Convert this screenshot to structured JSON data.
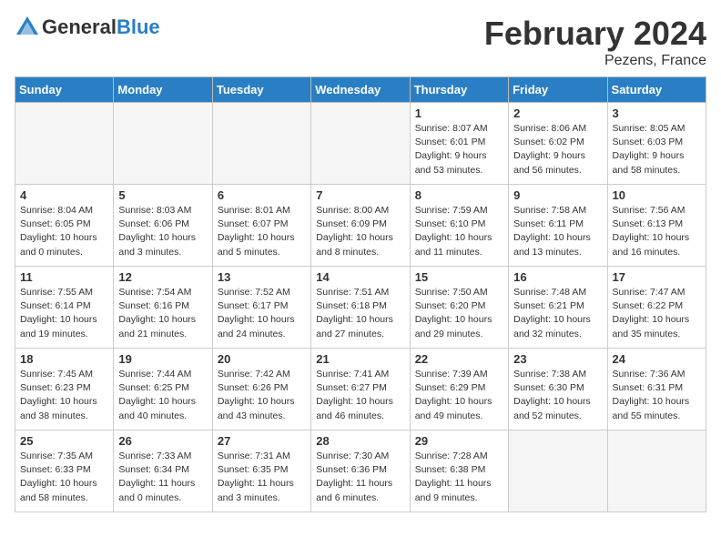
{
  "header": {
    "logo_general": "General",
    "logo_blue": "Blue",
    "month_year": "February 2024",
    "location": "Pezens, France"
  },
  "weekdays": [
    "Sunday",
    "Monday",
    "Tuesday",
    "Wednesday",
    "Thursday",
    "Friday",
    "Saturday"
  ],
  "weeks": [
    [
      {
        "day": "",
        "empty": true
      },
      {
        "day": "",
        "empty": true
      },
      {
        "day": "",
        "empty": true
      },
      {
        "day": "",
        "empty": true
      },
      {
        "day": "1",
        "sunrise": "Sunrise: 8:07 AM",
        "sunset": "Sunset: 6:01 PM",
        "daylight": "Daylight: 9 hours and 53 minutes."
      },
      {
        "day": "2",
        "sunrise": "Sunrise: 8:06 AM",
        "sunset": "Sunset: 6:02 PM",
        "daylight": "Daylight: 9 hours and 56 minutes."
      },
      {
        "day": "3",
        "sunrise": "Sunrise: 8:05 AM",
        "sunset": "Sunset: 6:03 PM",
        "daylight": "Daylight: 9 hours and 58 minutes."
      }
    ],
    [
      {
        "day": "4",
        "sunrise": "Sunrise: 8:04 AM",
        "sunset": "Sunset: 6:05 PM",
        "daylight": "Daylight: 10 hours and 0 minutes."
      },
      {
        "day": "5",
        "sunrise": "Sunrise: 8:03 AM",
        "sunset": "Sunset: 6:06 PM",
        "daylight": "Daylight: 10 hours and 3 minutes."
      },
      {
        "day": "6",
        "sunrise": "Sunrise: 8:01 AM",
        "sunset": "Sunset: 6:07 PM",
        "daylight": "Daylight: 10 hours and 5 minutes."
      },
      {
        "day": "7",
        "sunrise": "Sunrise: 8:00 AM",
        "sunset": "Sunset: 6:09 PM",
        "daylight": "Daylight: 10 hours and 8 minutes."
      },
      {
        "day": "8",
        "sunrise": "Sunrise: 7:59 AM",
        "sunset": "Sunset: 6:10 PM",
        "daylight": "Daylight: 10 hours and 11 minutes."
      },
      {
        "day": "9",
        "sunrise": "Sunrise: 7:58 AM",
        "sunset": "Sunset: 6:11 PM",
        "daylight": "Daylight: 10 hours and 13 minutes."
      },
      {
        "day": "10",
        "sunrise": "Sunrise: 7:56 AM",
        "sunset": "Sunset: 6:13 PM",
        "daylight": "Daylight: 10 hours and 16 minutes."
      }
    ],
    [
      {
        "day": "11",
        "sunrise": "Sunrise: 7:55 AM",
        "sunset": "Sunset: 6:14 PM",
        "daylight": "Daylight: 10 hours and 19 minutes."
      },
      {
        "day": "12",
        "sunrise": "Sunrise: 7:54 AM",
        "sunset": "Sunset: 6:16 PM",
        "daylight": "Daylight: 10 hours and 21 minutes."
      },
      {
        "day": "13",
        "sunrise": "Sunrise: 7:52 AM",
        "sunset": "Sunset: 6:17 PM",
        "daylight": "Daylight: 10 hours and 24 minutes."
      },
      {
        "day": "14",
        "sunrise": "Sunrise: 7:51 AM",
        "sunset": "Sunset: 6:18 PM",
        "daylight": "Daylight: 10 hours and 27 minutes."
      },
      {
        "day": "15",
        "sunrise": "Sunrise: 7:50 AM",
        "sunset": "Sunset: 6:20 PM",
        "daylight": "Daylight: 10 hours and 29 minutes."
      },
      {
        "day": "16",
        "sunrise": "Sunrise: 7:48 AM",
        "sunset": "Sunset: 6:21 PM",
        "daylight": "Daylight: 10 hours and 32 minutes."
      },
      {
        "day": "17",
        "sunrise": "Sunrise: 7:47 AM",
        "sunset": "Sunset: 6:22 PM",
        "daylight": "Daylight: 10 hours and 35 minutes."
      }
    ],
    [
      {
        "day": "18",
        "sunrise": "Sunrise: 7:45 AM",
        "sunset": "Sunset: 6:23 PM",
        "daylight": "Daylight: 10 hours and 38 minutes."
      },
      {
        "day": "19",
        "sunrise": "Sunrise: 7:44 AM",
        "sunset": "Sunset: 6:25 PM",
        "daylight": "Daylight: 10 hours and 40 minutes."
      },
      {
        "day": "20",
        "sunrise": "Sunrise: 7:42 AM",
        "sunset": "Sunset: 6:26 PM",
        "daylight": "Daylight: 10 hours and 43 minutes."
      },
      {
        "day": "21",
        "sunrise": "Sunrise: 7:41 AM",
        "sunset": "Sunset: 6:27 PM",
        "daylight": "Daylight: 10 hours and 46 minutes."
      },
      {
        "day": "22",
        "sunrise": "Sunrise: 7:39 AM",
        "sunset": "Sunset: 6:29 PM",
        "daylight": "Daylight: 10 hours and 49 minutes."
      },
      {
        "day": "23",
        "sunrise": "Sunrise: 7:38 AM",
        "sunset": "Sunset: 6:30 PM",
        "daylight": "Daylight: 10 hours and 52 minutes."
      },
      {
        "day": "24",
        "sunrise": "Sunrise: 7:36 AM",
        "sunset": "Sunset: 6:31 PM",
        "daylight": "Daylight: 10 hours and 55 minutes."
      }
    ],
    [
      {
        "day": "25",
        "sunrise": "Sunrise: 7:35 AM",
        "sunset": "Sunset: 6:33 PM",
        "daylight": "Daylight: 10 hours and 58 minutes."
      },
      {
        "day": "26",
        "sunrise": "Sunrise: 7:33 AM",
        "sunset": "Sunset: 6:34 PM",
        "daylight": "Daylight: 11 hours and 0 minutes."
      },
      {
        "day": "27",
        "sunrise": "Sunrise: 7:31 AM",
        "sunset": "Sunset: 6:35 PM",
        "daylight": "Daylight: 11 hours and 3 minutes."
      },
      {
        "day": "28",
        "sunrise": "Sunrise: 7:30 AM",
        "sunset": "Sunset: 6:36 PM",
        "daylight": "Daylight: 11 hours and 6 minutes."
      },
      {
        "day": "29",
        "sunrise": "Sunrise: 7:28 AM",
        "sunset": "Sunset: 6:38 PM",
        "daylight": "Daylight: 11 hours and 9 minutes."
      },
      {
        "day": "",
        "empty": true
      },
      {
        "day": "",
        "empty": true
      }
    ]
  ]
}
